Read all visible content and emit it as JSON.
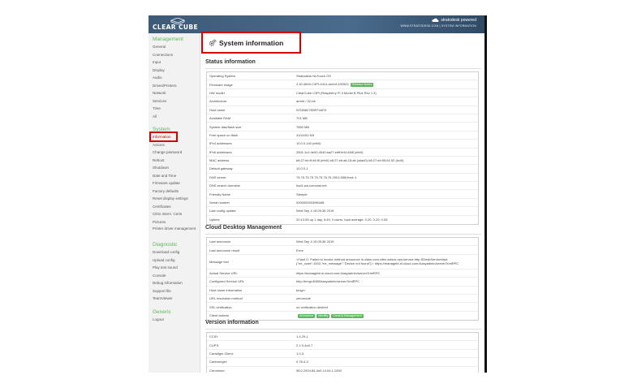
{
  "header": {
    "logo_text": "CLEAR CUBE",
    "brand_line1": "stratodesk powered",
    "brand_line2": "WWW.STRATODESK.COM | SYSTEM INFORMATION"
  },
  "sidebar": {
    "sections": [
      {
        "heading": "Management",
        "items": [
          "General",
          "Connections",
          "Input",
          "Display",
          "Audio",
          "Drives/Printers",
          "Network",
          "Services",
          "Time",
          "All"
        ]
      },
      {
        "heading": "System",
        "items": [
          "Information",
          "Actions",
          "Change password",
          "Reboot",
          "Shutdown",
          "Date and Time",
          "Firmware update",
          "Factory defaults",
          "Reset display settings",
          "Certificates",
          "Citrix Intern. Certs",
          "Pictures",
          "Printer driver management"
        ]
      },
      {
        "heading": "Diagnostic",
        "items": [
          "Download config",
          "Upload config",
          "Play test sound",
          "Console",
          "Debug information",
          "Support file",
          "TeamViewer"
        ]
      },
      {
        "heading": "Generic",
        "items": [
          "Logout"
        ]
      }
    ],
    "active_item": "Information"
  },
  "page": {
    "title": "System information"
  },
  "status": {
    "title": "Status information",
    "rows": [
      {
        "k": "Operating System",
        "v": "Stratodesk NoTouch OS"
      },
      {
        "k": "Firmware image",
        "v": "2.40.4600-C3PI-4414-armhf-190523",
        "badge": "Release Notes"
      },
      {
        "k": "HW model",
        "v": "ClearCube C3Pi (Raspberry Pi 3 Model B Plus Rev 1.3)"
      },
      {
        "k": "Architecture",
        "v": "armhf / 32-bit"
      },
      {
        "k": "Host name",
        "v": "NTDB827EBFF44F8"
      },
      {
        "k": "Available RAM",
        "v": "701 MB"
      },
      {
        "k": "System disk/flash size",
        "v": "7850 MB"
      },
      {
        "k": "Free space on flash",
        "v": "4104152 KB"
      },
      {
        "k": "IPv4 addresses",
        "v": "10.0.0.140 (eth0)"
      },
      {
        "k": "IPv6 addresses",
        "v": "2601:1c2:4e00:4040:ba27:ebff:fef4:44f8 (eth0)"
      },
      {
        "k": "MAC address",
        "v": "b8:27:eb:ff:44:f8 (eth0) b8:27:eb:a6:15:ab (wlan0) b8:27:eb:55:61:52 (hci0)"
      },
      {
        "k": "Default gateway",
        "v": "10.0.0.1"
      },
      {
        "k": "DNS server",
        "v": "75.75.75.75 75.75.76.76 2001:558:feed::1"
      },
      {
        "k": "DNS search domains",
        "v": "hsd1.wa.comcast.net"
      },
      {
        "k": "Friendly Name",
        "v": "Steeple"
      },
      {
        "k": "Serial number",
        "v": "00000000039ff44f8"
      },
      {
        "k": "Last config update",
        "v": "Wed Sep 4 19:05:36 2019"
      },
      {
        "k": "Uptime",
        "v": "20:10:55 up 1 day, 5:49, 0 users, load average: 0.20, 0.20, 0.05"
      }
    ]
  },
  "cloud": {
    "title": "Cloud Desktop Management",
    "rows": [
      {
        "k": "Last announce",
        "v": "Wed Sep 4 19:05:36 2019"
      },
      {
        "k": "Last announce result",
        "v": "Error"
      },
      {
        "k": "Message text",
        "v": "<Fault 0: 'Failed to invoke method announce in class com.citrix.wdsdc.xps.service.http.SDeskServiceImpl: {\"err_code\":1002,\"err_message\":\"Device not found\"}'> https://managebt.nl.cloud.com:/kasyadmin/server/XmlRPC",
        "multi": true
      },
      {
        "k": "Actual Service URL",
        "v": "https://managebt.nl.cloud.com:/kasyadmin/server/XmlRPC"
      },
      {
        "k": "Configured Service URL",
        "v": "http://bmgr:8080/kasyadmin/server/XmlRPC"
      },
      {
        "k": "Host name information",
        "v": "bmgr:/"
      },
      {
        "k": "URL resolution method",
        "v": "zeromode"
      },
      {
        "k": "SSL verification",
        "v": "no verification desired"
      },
      {
        "k": "Client actions",
        "v": "",
        "badges": [
          "Announce",
          "Identify",
          "Central Management"
        ]
      }
    ]
  },
  "version": {
    "title": "Version information",
    "rows": [
      {
        "k": "CCID:",
        "v": "1.4.29-1"
      },
      {
        "k": "CUPS:",
        "v": "2.1.9-4u0.7"
      },
      {
        "k": "Caradigm Client:",
        "v": "1.0-3"
      },
      {
        "k": "Cartmonger:",
        "v": "0.78.4-3"
      },
      {
        "k": "Chromium:",
        "v": "56.0.2924.84-0u0.14.04.1.1050"
      }
    ]
  },
  "colors": {
    "accent": "#5cb85c",
    "highlight": "#d40000",
    "topbar": "#3d5a77"
  }
}
